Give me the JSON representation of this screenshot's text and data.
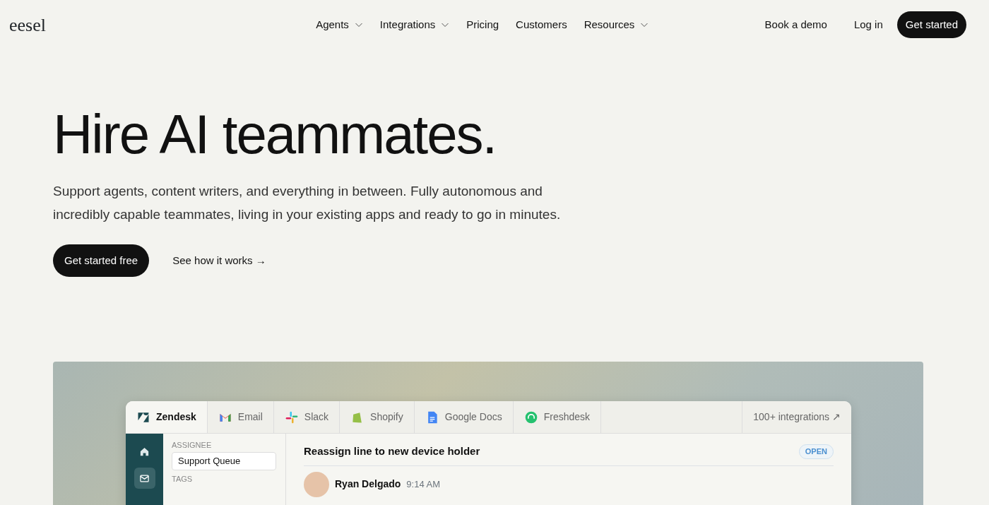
{
  "brand": "eesel",
  "nav": [
    {
      "label": "Agents",
      "has_menu": true
    },
    {
      "label": "Integrations",
      "has_menu": true
    },
    {
      "label": "Pricing",
      "has_menu": false
    },
    {
      "label": "Customers",
      "has_menu": false
    },
    {
      "label": "Resources",
      "has_menu": true
    }
  ],
  "actions": {
    "demo": "Book a demo",
    "login": "Log in",
    "start": "Get started"
  },
  "hero": {
    "title": "Hire AI teammates.",
    "subtitle": "Support agents, content writers, and everything in between. Fully autonomous and incredibly capable teammates, living in your existing apps and ready to go in minutes.",
    "primary": "Get started free",
    "secondary": "See how it works",
    "secondary_arrow": "→"
  },
  "app": {
    "tabs": [
      {
        "label": "Zendesk",
        "kind": "zendesk",
        "selected": true
      },
      {
        "label": "Email",
        "kind": "gmail",
        "selected": false
      },
      {
        "label": "Slack",
        "kind": "slack",
        "selected": false
      },
      {
        "label": "Shopify",
        "kind": "shopify",
        "selected": false
      },
      {
        "label": "Google Docs",
        "kind": "docs",
        "selected": false
      },
      {
        "label": "Freshdesk",
        "kind": "freshdesk",
        "selected": false
      }
    ],
    "more": "100+ integrations",
    "more_arrow": "↗",
    "rail": [
      {
        "kind": "home",
        "selected": false
      },
      {
        "kind": "mail",
        "selected": true
      }
    ],
    "fields": {
      "assignee_label": "ASSIGNEE",
      "assignee_value": "Support Queue",
      "tags_label": "TAGS"
    },
    "ticket": {
      "title": "Reassign line to new device holder",
      "status": "OPEN",
      "author": "Ryan Delgado",
      "time": "9:14 AM"
    }
  }
}
